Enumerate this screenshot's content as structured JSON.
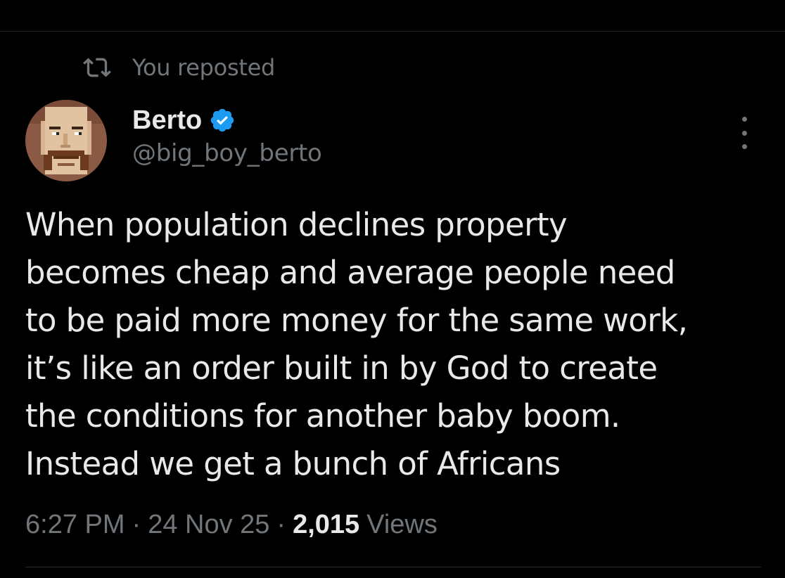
{
  "repost": {
    "icon": "repost-icon",
    "text": "You reposted"
  },
  "author": {
    "display_name": "Berto",
    "handle": "@big_boy_berto",
    "verified": true,
    "verified_icon": "verified-badge-icon",
    "avatar": "pixel-art-mustache-man-avatar"
  },
  "more_icon": "more-options-icon",
  "tweet": {
    "text": "When population declines property\nbecomes cheap and average people need\nto be paid more money for the same work,\nit’s like an order built in by God to create\nthe conditions for another baby boom.\nInstead we get a bunch of Africans"
  },
  "meta": {
    "time": "6:27 PM",
    "date": "24 Nov 25",
    "separator": "·",
    "views_count": "2,015",
    "views_label": "Views"
  },
  "colors": {
    "background": "#000000",
    "primary_text": "#e7e9ea",
    "secondary_text": "#71767b",
    "verified_blue": "#1d9bf0"
  }
}
